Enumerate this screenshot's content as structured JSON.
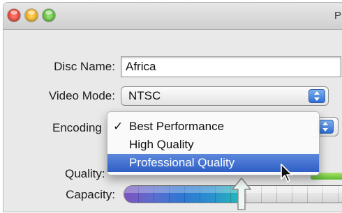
{
  "window": {
    "title_partial": "P"
  },
  "form": {
    "disc_name": {
      "label": "Disc Name:",
      "value": "Africa"
    },
    "video_mode": {
      "label": "Video Mode:",
      "value": "NTSC"
    },
    "encoding": {
      "label_partial": "Encoding"
    },
    "quality": {
      "label_partial": "Quality:"
    },
    "capacity": {
      "label": "Capacity:"
    }
  },
  "encoding_menu": {
    "checked_index": 0,
    "highlighted_index": 2,
    "check_glyph": "✓",
    "items": [
      {
        "label": "Best Performance"
      },
      {
        "label": "High Quality"
      },
      {
        "label": "Professional Quality"
      }
    ]
  },
  "capacity_meter": {
    "used_fraction": 0.52
  },
  "colors": {
    "menu_highlight": "#3b6cd0",
    "stepper_blue": "#2f6fd3",
    "quality_green": "#6cc53a"
  },
  "icons": [
    "close-button",
    "minimize-button",
    "zoom-button",
    "popup-stepper-icon",
    "check-icon",
    "mouse-pointer-icon",
    "capacity-marker-arrow"
  ]
}
